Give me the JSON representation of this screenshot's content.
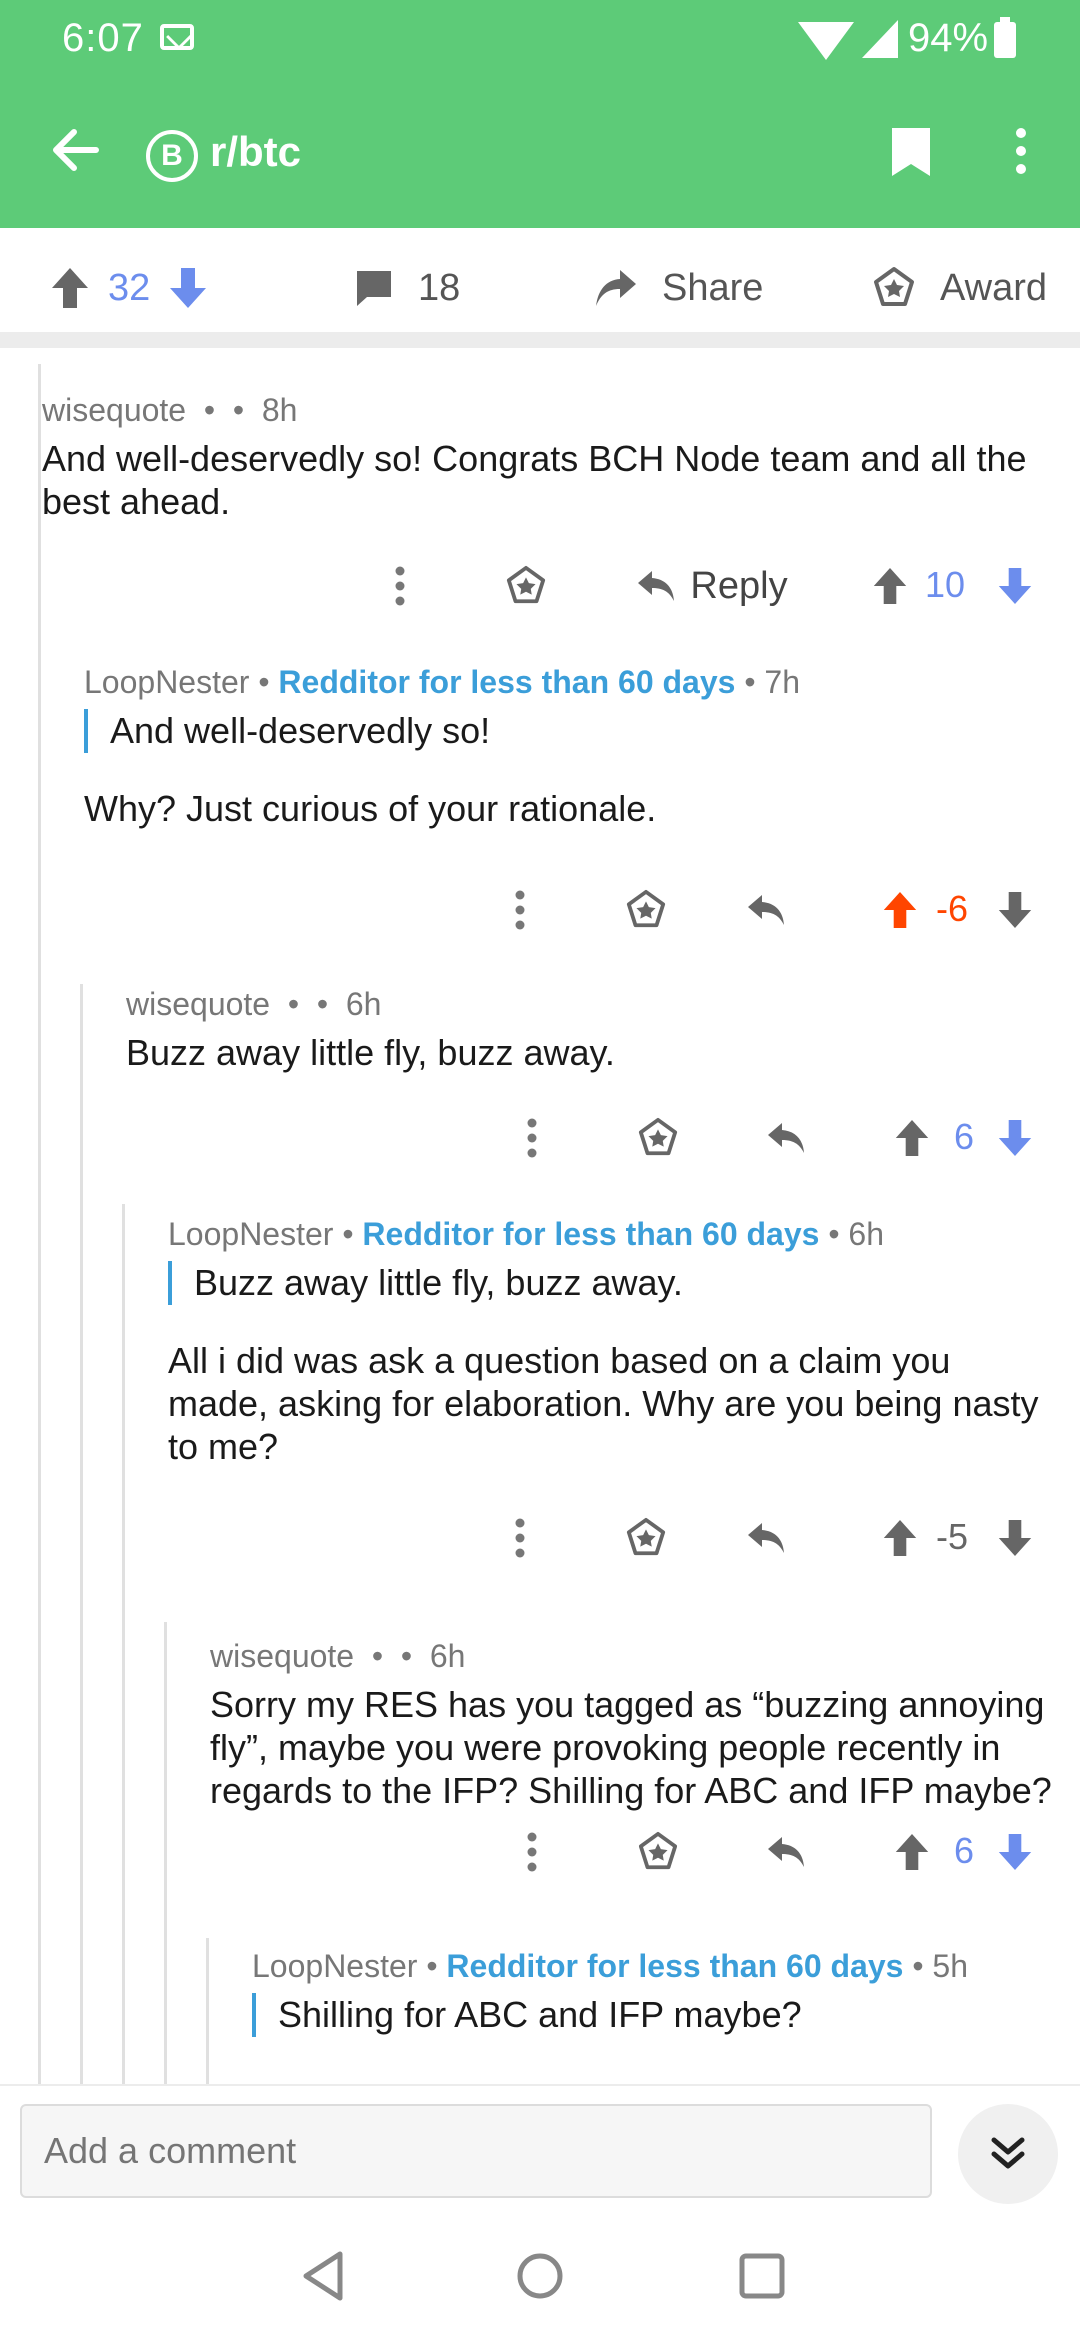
{
  "status": {
    "time": "6:07",
    "battery": "94%"
  },
  "header": {
    "subreddit": "r/btc",
    "badge": "B"
  },
  "post_actions": {
    "score": "32",
    "comments": "18",
    "share": "Share",
    "award": "Award"
  },
  "comments": [
    {
      "author": "wisequote",
      "flair": "",
      "age": "8h",
      "quote": "",
      "text": "And well-deservedly so! Congrats BCH Node team and all the best ahead.",
      "score": "10",
      "reply_label": "Reply",
      "vote_state": "none"
    },
    {
      "author": "LoopNester",
      "flair": "Redditor for less than 60 days",
      "age": "7h",
      "quote": "And well-deservedly so!",
      "text": "Why? Just curious of your rationale.",
      "score": "-6",
      "vote_state": "up"
    },
    {
      "author": "wisequote",
      "flair": "",
      "age": "6h",
      "quote": "",
      "text": "Buzz away little fly, buzz away.",
      "score": "6",
      "vote_state": "down"
    },
    {
      "author": "LoopNester",
      "flair": "Redditor for less than 60 days",
      "age": "6h",
      "quote": "Buzz away little fly, buzz away.",
      "text": "All i did was ask a question based on a claim you made, asking for elaboration. Why are you being nasty to me?",
      "score": "-5",
      "vote_state": "none"
    },
    {
      "author": "wisequote",
      "flair": "",
      "age": "6h",
      "quote": "",
      "text": "Sorry my RES has you tagged as “buzzing annoying fly”, maybe you were provoking people recently in regards to the IFP? Shilling for ABC and IFP maybe?",
      "score": "6",
      "vote_state": "down"
    },
    {
      "author": "LoopNester",
      "flair": "Redditor for less than 60 days",
      "age": "5h",
      "quote": "Shilling for ABC and IFP maybe?",
      "text": "",
      "score": "",
      "vote_state": "none"
    }
  ],
  "composer": {
    "placeholder": "Add a comment"
  },
  "colors": {
    "accent": "#5dcb78",
    "downvote": "#6c8ded",
    "upvote": "#ff4500",
    "flair": "#3b9ed9"
  }
}
